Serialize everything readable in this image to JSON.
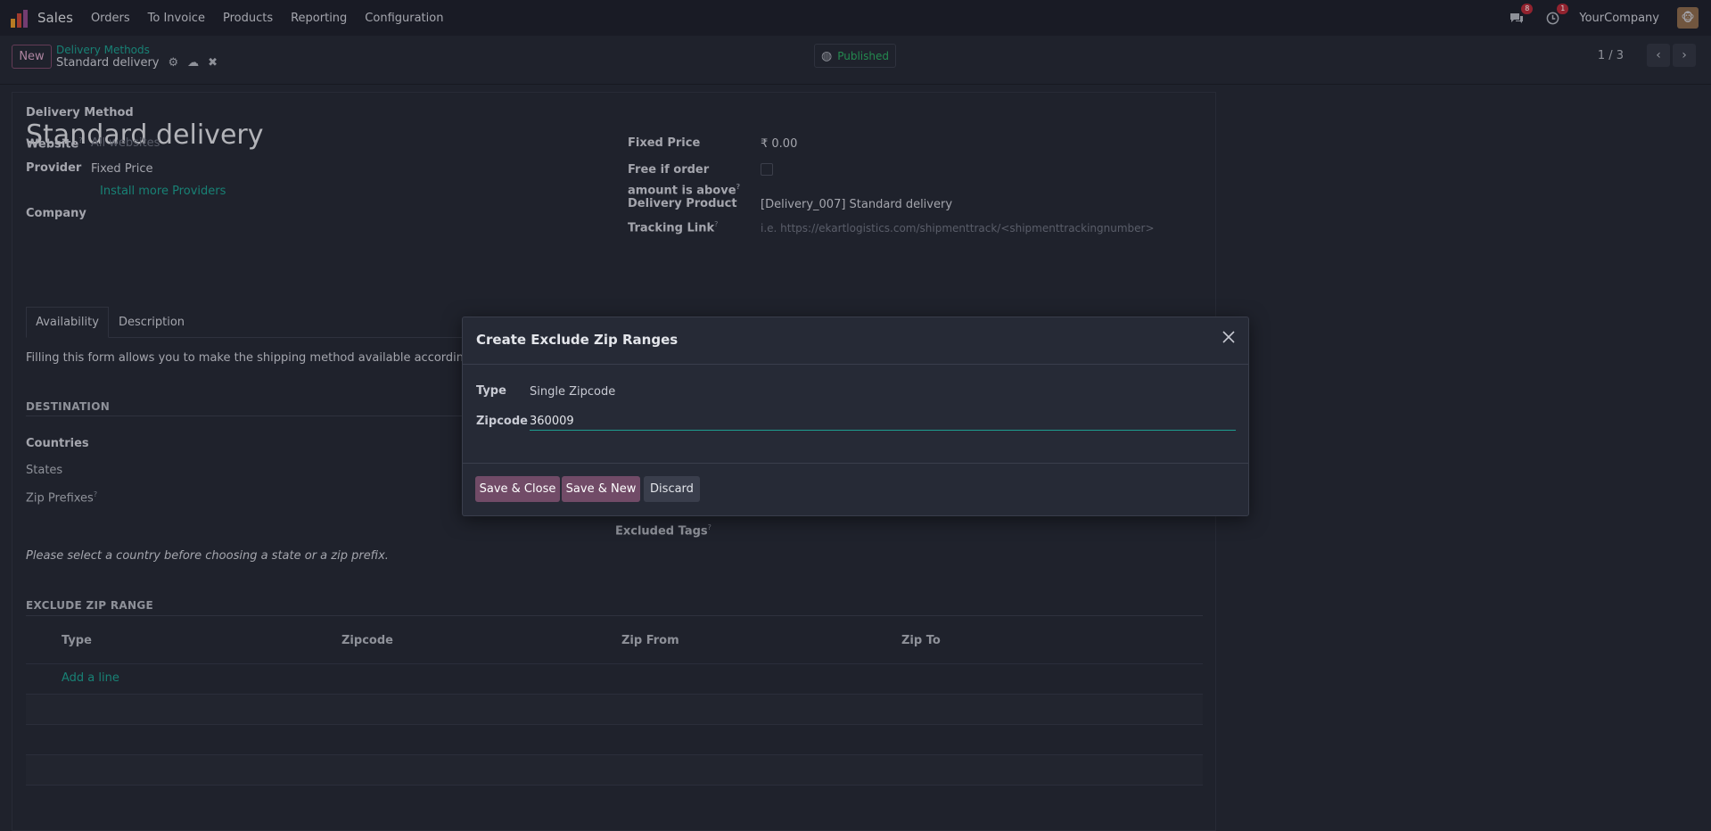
{
  "topbar": {
    "app_name": "Sales",
    "menu": [
      "Orders",
      "To Invoice",
      "Products",
      "Reporting",
      "Configuration"
    ],
    "messages_badge": "8",
    "activities_badge": "1",
    "company": "YourCompany",
    "brand_color": "#e0962b"
  },
  "control_panel": {
    "new_label": "New",
    "breadcrumb_parent": "Delivery Methods",
    "breadcrumb_current": "Standard delivery",
    "published_label": "Published",
    "pager": "1 / 3"
  },
  "form": {
    "title_label": "Delivery Method",
    "title": "Standard delivery",
    "website_label": "Website",
    "website_placeholder": "All websites",
    "provider_label": "Provider",
    "provider_value": "Fixed Price",
    "install_link": "Install more Providers",
    "company_label": "Company",
    "fixed_price_label": "Fixed Price",
    "fixed_price_value": "₹ 0.00",
    "free_label": "Free if order amount is above",
    "delivery_product_label": "Delivery Product",
    "delivery_product_value": "[Delivery_007] Standard delivery",
    "tracking_label": "Tracking Link",
    "tracking_placeholder": "i.e. https://ekartlogistics.com/shipmenttrack/<shipmenttrackingnumber>",
    "tabs": [
      "Availability",
      "Description"
    ],
    "availability_text": "Filling this form allows you to make the shipping method available according to the co",
    "destination_header": "DESTINATION",
    "countries_label": "Countries",
    "states_label": "States",
    "zip_prefixes_label": "Zip Prefixes",
    "excluded_tags_label": "Excluded Tags",
    "country_hint": "Please select a country before choosing a state or a zip prefix.",
    "exclude_header": "EXCLUDE ZIP RANGE",
    "table_headers": [
      "Type",
      "Zipcode",
      "Zip From",
      "Zip To"
    ],
    "add_line": "Add a line"
  },
  "modal": {
    "title": "Create Exclude Zip Ranges",
    "type_label": "Type",
    "type_value": "Single Zipcode",
    "zipcode_label": "Zipcode",
    "zipcode_value": "360009",
    "save_close": "Save & Close",
    "save_new": "Save & New",
    "discard": "Discard",
    "primary_color": "#714b67"
  }
}
